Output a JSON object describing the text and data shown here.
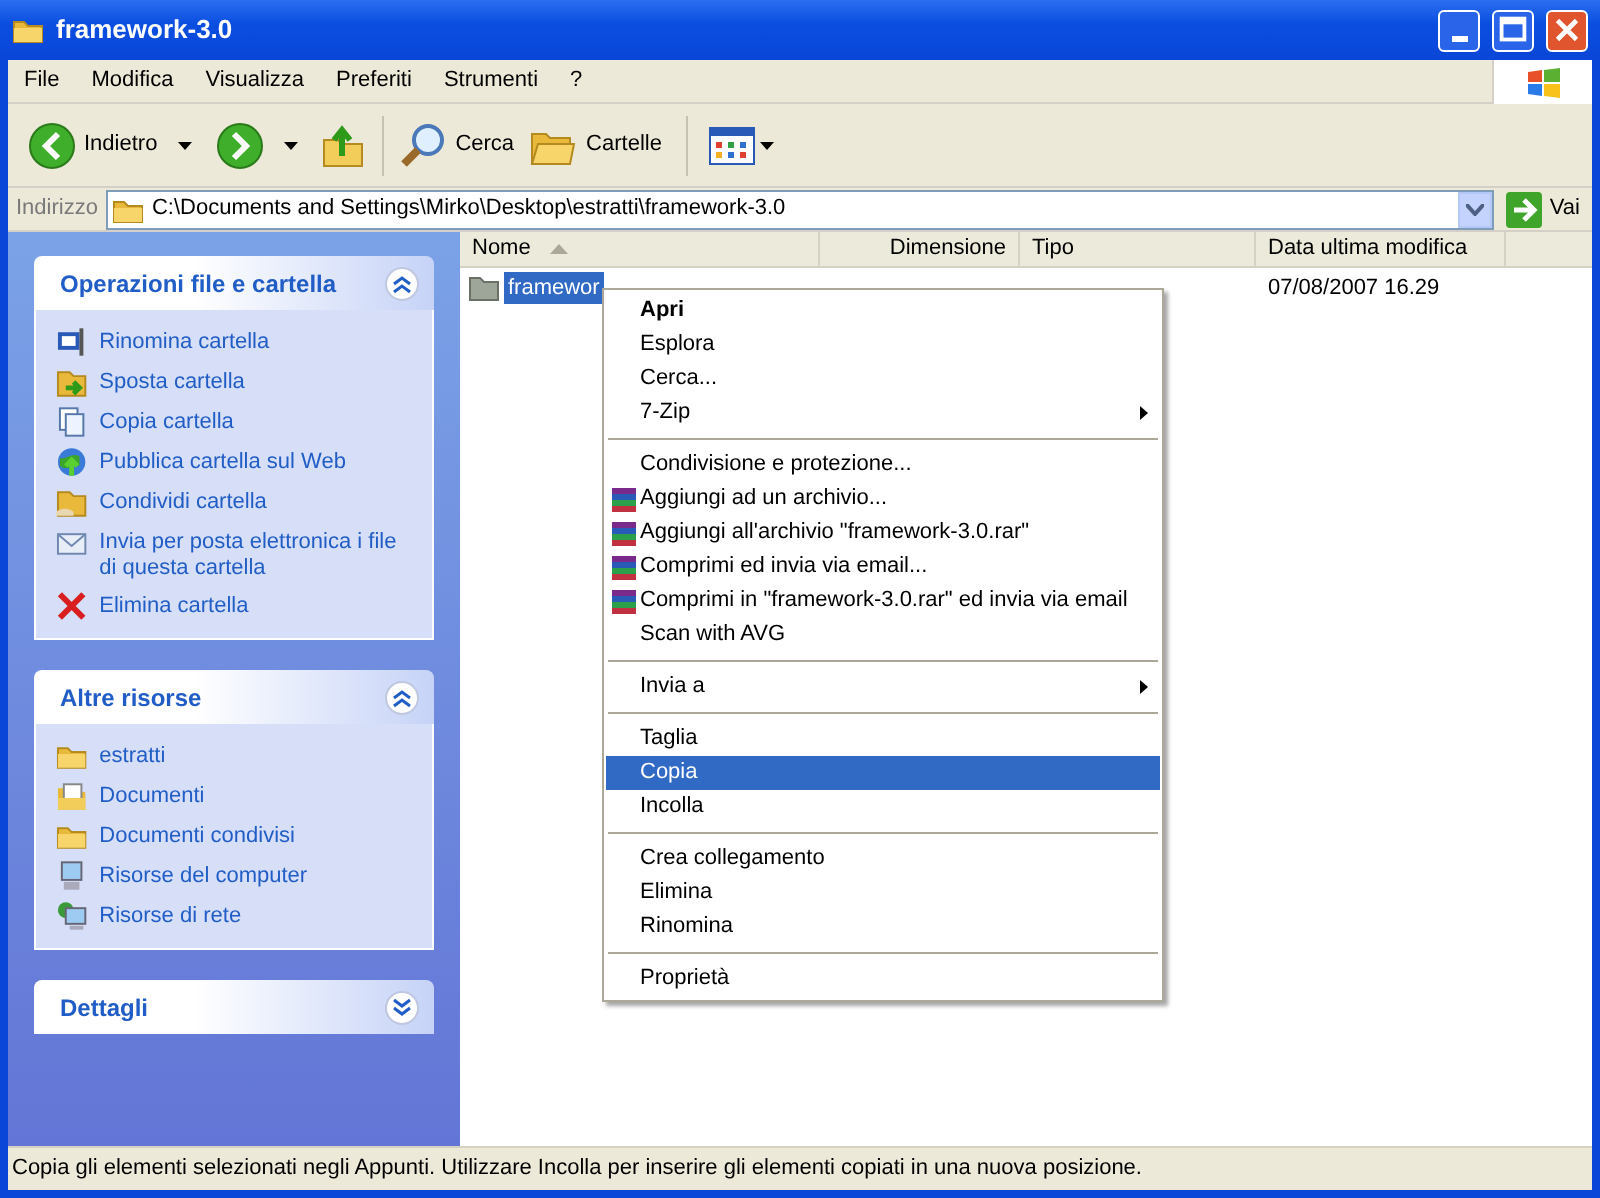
{
  "window": {
    "title": "framework-3.0"
  },
  "menu_bar": [
    "File",
    "Modifica",
    "Visualizza",
    "Preferiti",
    "Strumenti",
    "?"
  ],
  "toolbar": [
    {
      "kind": "back",
      "label": "Indietro"
    },
    {
      "kind": "forward"
    },
    {
      "kind": "up"
    },
    {
      "kind": "search",
      "label": "Cerca"
    },
    {
      "kind": "folders",
      "label": "Cartelle"
    },
    {
      "kind": "views"
    }
  ],
  "address_bar": {
    "label": "Indirizzo",
    "value": "C:\\Documents and Settings\\Mirko\\Desktop\\estratti\\framework-3.0",
    "go": "Vai"
  },
  "sidebar": [
    {
      "title": "Operazioni file e cartella",
      "expanded": true,
      "items": [
        "Rinomina cartella",
        "Sposta cartella",
        "Copia cartella",
        "Pubblica cartella sul Web",
        "Condividi cartella",
        "Invia per posta elettronica i file di questa cartella",
        "Elimina cartella"
      ]
    },
    {
      "title": "Altre risorse",
      "expanded": true,
      "items": [
        "estratti",
        "Documenti",
        "Documenti condivisi",
        "Risorse del computer",
        "Risorse di rete"
      ]
    },
    {
      "title": "Dettagli",
      "expanded": false
    }
  ],
  "table": {
    "columns": [
      "Nome",
      "Dimensione",
      "Tipo",
      "Data ultima modifica"
    ],
    "rows": [
      {
        "name": "framewor",
        "date": "07/08/2007 16.29",
        "selected": true
      }
    ]
  },
  "context_menu": {
    "items": [
      {
        "kind": "item",
        "label": "Apri",
        "bold": true,
        "selected": false
      },
      {
        "kind": "item",
        "label": "Esplora",
        "selected": false
      },
      {
        "kind": "item",
        "label": "Cerca...",
        "selected": false
      },
      {
        "kind": "item",
        "label": "7-Zip",
        "submenu": true,
        "selected": false
      },
      {
        "kind": "separator"
      },
      {
        "kind": "item",
        "label": "Condivisione e protezione...",
        "selected": false
      },
      {
        "kind": "archive",
        "label": "Aggiungi ad un archivio...",
        "selected": false
      },
      {
        "kind": "archive",
        "label": "Aggiungi all'archivio \"framework-3.0.rar\"",
        "selected": false
      },
      {
        "kind": "archive",
        "label": "Comprimi ed invia via email...",
        "selected": false
      },
      {
        "kind": "archive",
        "label": "Comprimi in \"framework-3.0.rar\" ed invia via email",
        "selected": false
      },
      {
        "kind": "item",
        "label": "Scan with AVG",
        "selected": false
      },
      {
        "kind": "separator"
      },
      {
        "kind": "item",
        "label": "Invia a",
        "submenu": true,
        "selected": false
      },
      {
        "kind": "separator"
      },
      {
        "kind": "item",
        "label": "Taglia",
        "selected": false
      },
      {
        "kind": "item",
        "label": "Copia",
        "selected": true
      },
      {
        "kind": "item",
        "label": "Incolla",
        "selected": false
      },
      {
        "kind": "separator"
      },
      {
        "kind": "item",
        "label": "Crea collegamento",
        "selected": false
      },
      {
        "kind": "item",
        "label": "Elimina",
        "selected": false
      },
      {
        "kind": "item",
        "label": "Rinomina",
        "selected": false
      },
      {
        "kind": "separator"
      },
      {
        "kind": "item",
        "label": "Proprietà",
        "selected": false
      }
    ]
  },
  "status_bar": "Copia gli elementi selezionati negli Appunti. Utilizzare Incolla per inserire gli elementi copiati in una nuova posizione."
}
